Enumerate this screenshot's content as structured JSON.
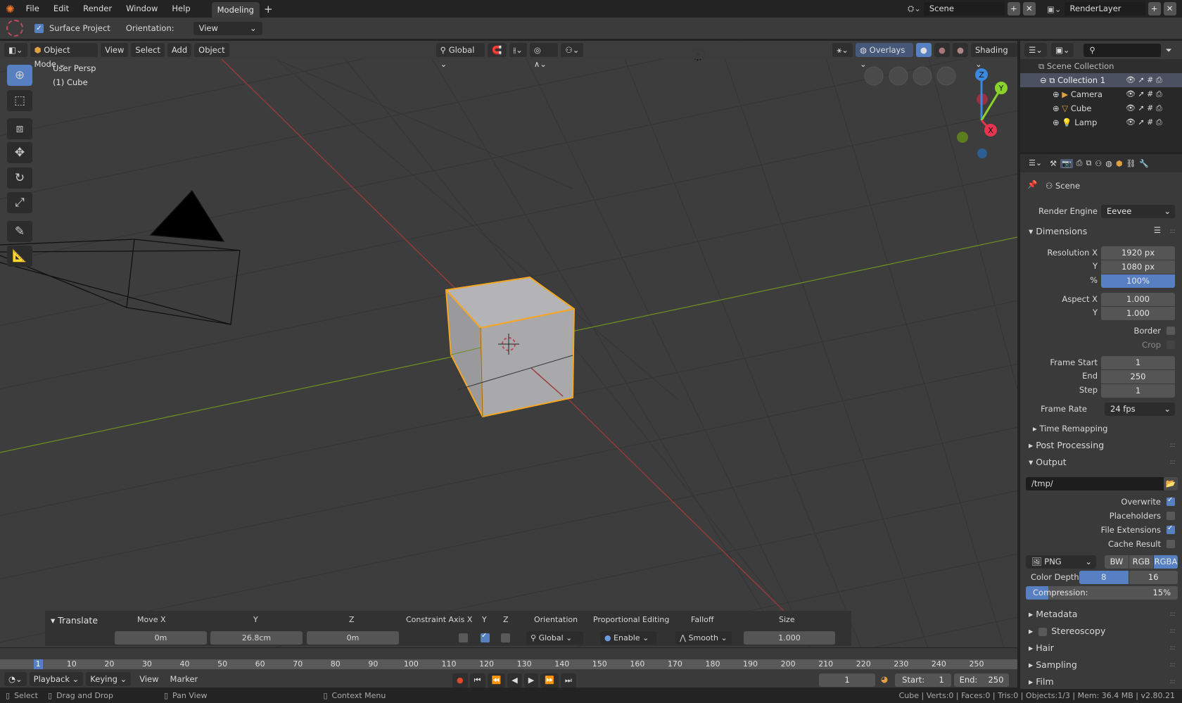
{
  "topbar": {
    "menus": [
      "File",
      "Edit",
      "Render",
      "Window",
      "Help"
    ],
    "workspace_tab": "Modeling",
    "add_tab": "+",
    "scene": "Scene",
    "render_layer": "RenderLayer"
  },
  "tool_header": {
    "surface_project": "Surface Project",
    "surface_project_checked": true,
    "orientation_label": "Orientation:",
    "orientation_value": "View"
  },
  "viewport_header": {
    "mode": "Object Mode",
    "menus": [
      "View",
      "Select",
      "Add",
      "Object"
    ],
    "transform_orientation": "Global",
    "overlays": "Overlays",
    "shading": "Shading"
  },
  "viewport": {
    "view_name": "User Persp",
    "active_object": "(1) Cube",
    "gizmo_axes": {
      "x": "X",
      "y": "Y",
      "z": "Z"
    },
    "colors": {
      "x_axis": "#9b3a3a",
      "y_axis": "#6b8e23",
      "selection": "#f5a623",
      "background": "#3d3d3d"
    }
  },
  "left_toolbar": [
    "cursor-icon",
    "box-select-icon",
    "transform-icon",
    "move-icon",
    "rotate-icon",
    "scale-icon",
    "annotate-icon",
    "measure-icon"
  ],
  "translate_panel": {
    "title": "Translate",
    "move_x_label": "Move X",
    "y_label": "Y",
    "z_label": "Z",
    "move_x": "0m",
    "move_y": "26.8cm",
    "move_z": "0m",
    "constraint_label": "Constraint Axis X",
    "constraint_y": "Y",
    "constraint_z": "Z",
    "constraint": {
      "x": false,
      "y": true,
      "z": false
    },
    "orientation_label": "Orientation",
    "orientation": "Global",
    "prop_edit_label": "Proportional Editing",
    "prop_edit": "Enable",
    "falloff_label": "Falloff",
    "falloff": "Smooth",
    "size_label": "Size",
    "size": "1.000"
  },
  "timeline": {
    "current_frame": "1",
    "ticks": [
      10,
      20,
      30,
      40,
      50,
      60,
      70,
      80,
      90,
      100,
      110,
      120,
      130,
      140,
      150,
      160,
      170,
      180,
      190,
      200,
      210,
      220,
      230,
      240,
      250
    ],
    "menus": [
      "Playback",
      "Keying",
      "View",
      "Marker"
    ],
    "frame_field": "1",
    "start_label": "Start:",
    "start": "1",
    "end_label": "End:",
    "end": "250"
  },
  "status": {
    "select": "Select",
    "drag": "Drag and Drop",
    "pan": "Pan View",
    "context": "Context Menu",
    "stats": "Cube | Verts:0 | Faces:0 | Tris:0 | Objects:1/3 | Mem: 36.4 MB | v2.80.21"
  },
  "outliner": {
    "root": "Scene Collection",
    "collection": "Collection 1",
    "items": [
      "Camera",
      "Cube",
      "Lamp"
    ]
  },
  "properties": {
    "context": "Scene",
    "render_engine_label": "Render Engine",
    "render_engine": "Eevee",
    "dimensions": "Dimensions",
    "res_x_label": "Resolution X",
    "res_x": "1920 px",
    "res_y_label": "Y",
    "res_y": "1080 px",
    "res_pct_label": "%",
    "res_pct": "100%",
    "aspect_x_label": "Aspect X",
    "aspect_x": "1.000",
    "aspect_y_label": "Y",
    "aspect_y": "1.000",
    "border": "Border",
    "crop": "Crop",
    "frame_start_label": "Frame Start",
    "frame_start": "1",
    "end_label": "End",
    "end": "250",
    "step_label": "Step",
    "step": "1",
    "frame_rate_label": "Frame Rate",
    "frame_rate": "24 fps",
    "time_remapping": "Time Remapping",
    "post_processing": "Post Processing",
    "output": "Output",
    "output_path": "/tmp/",
    "overwrite": "Overwrite",
    "placeholders": "Placeholders",
    "file_extensions": "File Extensions",
    "cache_result": "Cache Result",
    "checks": {
      "overwrite": true,
      "placeholders": false,
      "file_extensions": true,
      "cache_result": false,
      "border": false,
      "crop": false,
      "stereoscopy": false
    },
    "format": "PNG",
    "color_modes": [
      "BW",
      "RGB",
      "RGBA"
    ],
    "color_mode_selected": "RGBA",
    "color_depth_label": "Color Depth:",
    "depths": [
      "8",
      "16"
    ],
    "depth_selected": "8",
    "compression_label": "Compression:",
    "compression": "15%",
    "compression_value": 15,
    "sections": [
      "Metadata",
      "Stereoscopy",
      "Hair",
      "Sampling",
      "Film"
    ],
    "accent": "#5680c2"
  }
}
